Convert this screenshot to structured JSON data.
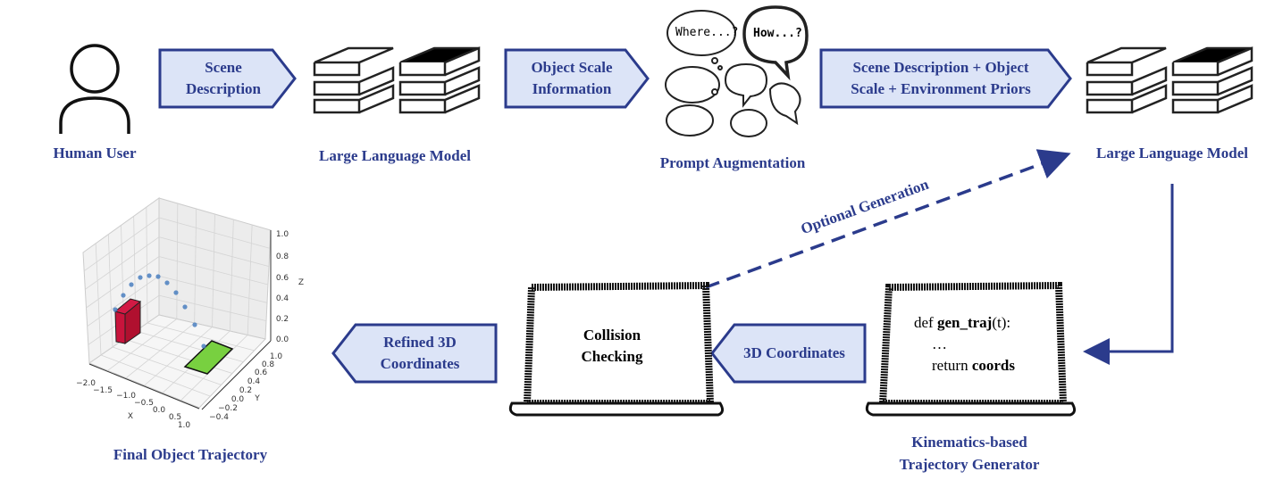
{
  "nodes": {
    "human_user": "Human User",
    "llm_1": "Large Language Model",
    "prompt_augmentation": "Prompt Augmentation",
    "llm_2": "Large Language Model",
    "trajectory_generator_line1": "Kinematics-based",
    "trajectory_generator_line2": "Trajectory Generator",
    "final_trajectory": "Final Object Trajectory"
  },
  "arrows": {
    "scene_description": "Scene Description",
    "object_scale": "Object Scale Information",
    "combined_line1": "Scene Description + Object",
    "combined_line2": "Scale + Environment Priors",
    "coordinates": "3D Coordinates",
    "refined_line1": "Refined 3D",
    "refined_line2": "Coordinates",
    "optional_generation": "Optional Generation"
  },
  "bubbles": {
    "where": "Where...?",
    "how": "How...?"
  },
  "code_laptop": {
    "line1_prefix": "def ",
    "line1_bold": "gen_traj",
    "line1_suffix": "(t):",
    "line2": "…",
    "line3_prefix": "return ",
    "line3_bold": "coords"
  },
  "collision_laptop": {
    "line1": "Collision",
    "line2": "Checking"
  },
  "plot": {
    "x_label": "X",
    "y_label": "Y",
    "z_label": "Z",
    "x_ticks": [
      "−2.0",
      "−1.5",
      "−1.0",
      "−0.5",
      "0.0",
      "0.5",
      "1.0"
    ],
    "y_ticks": [
      "1.0",
      "0.8",
      "0.6",
      "0.4",
      "0.2",
      "0.0",
      "−0.2",
      "−0.4"
    ],
    "z_ticks": [
      "1.0",
      "0.8",
      "0.6",
      "0.4",
      "0.2",
      "0.0"
    ],
    "colors": {
      "box": "#c8143c",
      "target": "#78d040",
      "points": "#4a7fc0"
    }
  },
  "colors": {
    "accent": "#2b3b8c",
    "arrow_fill": "#dce4f7"
  }
}
